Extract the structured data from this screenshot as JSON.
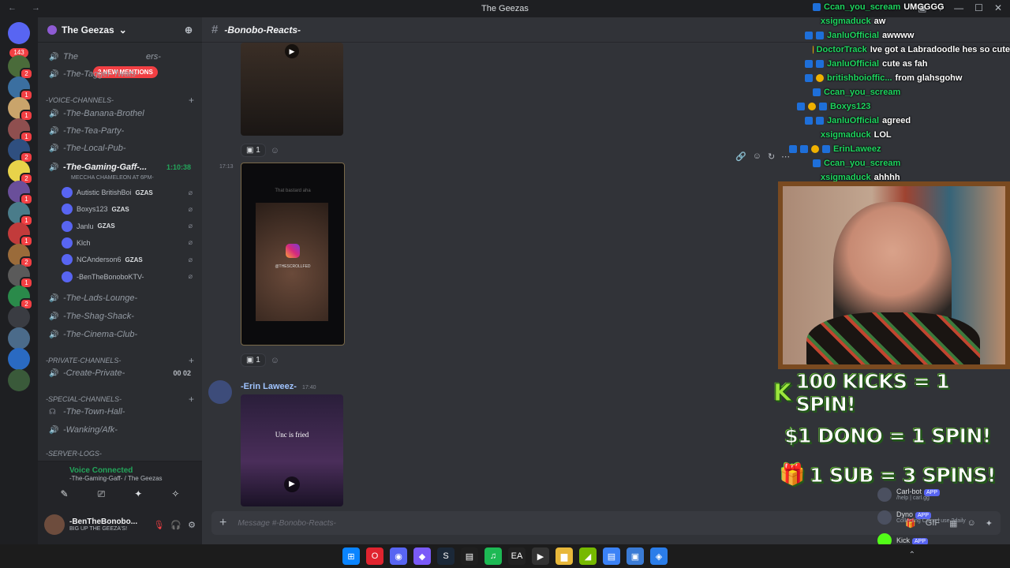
{
  "window": {
    "title": "The Geezas",
    "nav": "← →",
    "controls": [
      "▣",
      "?",
      "—",
      "☐",
      "✕"
    ]
  },
  "guild_bar": {
    "home_badge": "143",
    "guilds": [
      {
        "badge": "2",
        "color": "#4a6b3a"
      },
      {
        "badge": "1",
        "color": "#3b6fa0"
      },
      {
        "badge": "1",
        "color": "#c9a46b"
      },
      {
        "badge": "1",
        "color": "#8f4f4f"
      },
      {
        "badge": "2",
        "color": "#2f4f7f"
      },
      {
        "badge": "2",
        "color": "#e8d34a"
      },
      {
        "badge": "1",
        "color": "#6a4f9a"
      },
      {
        "badge": "1",
        "color": "#4a7c8a"
      },
      {
        "badge": "1",
        "color": "#c23b3b"
      },
      {
        "badge": "2",
        "color": "#9a6b3a"
      },
      {
        "badge": "1",
        "color": "#5a5a5a"
      },
      {
        "badge": "2",
        "color": "#2a8a4a"
      },
      {
        "badge": "",
        "color": "#3a3c42"
      },
      {
        "badge": "",
        "color": "#4b6b8a"
      },
      {
        "badge": "",
        "color": "#2a6ac2"
      },
      {
        "badge": "",
        "color": "#3a5a3a"
      }
    ]
  },
  "server": {
    "name": "The Geezas",
    "chevron": "⌄",
    "mention_pill": "2 NEW MENTIONS",
    "channels_top": [
      {
        "label": "The",
        "tail": "ers-",
        "icon": "🔊"
      },
      {
        "label": "-The-Tagger-Twats-",
        "icon": "🔊"
      }
    ],
    "voice_category": "-VOICE-CHANNELS-",
    "voice_channels": [
      {
        "label": "-The-Banana-Brothel",
        "icon": "🔊"
      },
      {
        "label": "-The-Tea-Party-",
        "icon": "🔊"
      },
      {
        "label": "-The-Local-Pub-",
        "icon": "🔊"
      },
      {
        "label": "-The-Gaming-Gaff-...",
        "icon": "🔊",
        "time": "1:10:38"
      }
    ],
    "event_line": "MECCHA CHAMELEON AT 6PM-",
    "voice_users": [
      {
        "name": "Autistic BritishBoi",
        "tag": "GZAS"
      },
      {
        "name": "Boxys123",
        "tag": "GZAS"
      },
      {
        "name": "Janlu",
        "tag": "GZAS"
      },
      {
        "name": "Klch",
        "tag": ""
      },
      {
        "name": "NCAnderson6",
        "tag": "GZAS"
      },
      {
        "name": "-BenTheBonoboKTV-",
        "tag": ""
      }
    ],
    "voice_channels_2": [
      {
        "label": "-The-Lads-Lounge-",
        "icon": "🔊"
      },
      {
        "label": "-The-Shag-Shack-",
        "icon": "🔊"
      },
      {
        "label": "-The-Cinema-Club-",
        "icon": "🔊"
      }
    ],
    "private_category": "-PRIVATE-CHANNELS-",
    "create_private": {
      "label": "-Create-Private-",
      "count": "00  02"
    },
    "special_category": "-SPECIAL-CHANNELS-",
    "special_channels": [
      {
        "label": "-The-Town-Hall-",
        "icon": "☊"
      },
      {
        "label": "-Wanking/Afk-",
        "icon": "🔊"
      }
    ],
    "logs_category": "-SERVER-LOGS-"
  },
  "voice_panel": {
    "status": "Voice Connected",
    "location": "-The-Gaming-Gaff- / The Geezas",
    "buttons": [
      "✎",
      "⎚",
      "✦",
      "✧"
    ]
  },
  "user_panel": {
    "name": "-BenTheBonobo...",
    "status": "BIG UP THE GEEZA'S!",
    "controls": [
      "🎙",
      "🎧",
      "⚙"
    ]
  },
  "channel": {
    "name": "-Bonobo-Reacts-",
    "hash": "#",
    "react_count_1": "1",
    "react_count_2": "1",
    "time_mid": "17:13",
    "video_caption_top": "That bastard aha",
    "video_caption_mid": "@THESCROLLFED",
    "author": "-Erin Laweez-",
    "author_time": "17:40",
    "video_caption_bottom": "Unc is fried",
    "hover_tools": [
      "🔗",
      "☺",
      "↻",
      "⋯"
    ]
  },
  "composer": {
    "placeholder": "Message #-Bonobo-Reacts-",
    "tools": [
      "🎁",
      "GIF",
      "▦",
      "☺",
      "✦"
    ]
  },
  "chat_overlay": [
    {
      "user": "Ccan_you_scream",
      "msg": "UMGGGG",
      "badges": [
        "b"
      ]
    },
    {
      "user": "xsigmaduck",
      "msg": "aw",
      "badges": []
    },
    {
      "user": "JanluOfficial",
      "msg": "awwww",
      "badges": [
        "b",
        "b"
      ]
    },
    {
      "user": "DoctorTrack",
      "msg": "Ive got a Labradoodle hes so cute",
      "badges": [
        "y"
      ]
    },
    {
      "user": "JanluOfficial",
      "msg": "cute as fah",
      "badges": [
        "b",
        "b"
      ]
    },
    {
      "user": "britishboioffic...",
      "msg": "from glahsgohw",
      "badges": [
        "b",
        "y"
      ]
    },
    {
      "user": "Ccan_you_scream",
      "msg": "",
      "badges": [
        "b"
      ]
    },
    {
      "user": "Boxys123",
      "msg": "",
      "badges": [
        "b",
        "y",
        "b"
      ]
    },
    {
      "user": "JanluOfficial",
      "msg": "agreed",
      "badges": [
        "b",
        "b"
      ]
    },
    {
      "user": "xsigmaduck",
      "msg": "LOL",
      "badges": []
    },
    {
      "user": "ErinLaweez",
      "msg": "",
      "badges": [
        "b",
        "b",
        "y",
        "b"
      ]
    },
    {
      "user": "Ccan_you_scream",
      "msg": "",
      "badges": [
        "b"
      ]
    },
    {
      "user": "xsigmaduck",
      "msg": "ahhhh",
      "badges": []
    }
  ],
  "promos": [
    {
      "symbol": "K",
      "text": "100 KICKS = 1 SPIN!"
    },
    {
      "symbol": "$",
      "text": "$1 DONO = 1 SPIN!"
    },
    {
      "symbol": "🎁",
      "text": "1 SUB = 3 SPINS!"
    }
  ],
  "member_peek": [
    {
      "name": "Carl-bot",
      "badge": "APP",
      "sub": "/help | carl.gg"
    },
    {
      "name": "Dyno",
      "badge": "APP",
      "sub": "Collecting Coins | use ?daily"
    },
    {
      "name": "Kick",
      "badge": "APP",
      "sub": ""
    }
  ],
  "taskbar": {
    "icons": [
      {
        "glyph": "⊞",
        "color": "#0a84ff"
      },
      {
        "glyph": "O",
        "color": "#e0242f"
      },
      {
        "glyph": "◉",
        "color": "#5865f2"
      },
      {
        "glyph": "◆",
        "color": "#7a5af8"
      },
      {
        "glyph": "S",
        "color": "#1b2838"
      },
      {
        "glyph": "▤",
        "color": "#1f1f1f"
      },
      {
        "glyph": "♫",
        "color": "#1db954"
      },
      {
        "glyph": "EA",
        "color": "#222222"
      },
      {
        "glyph": "▶",
        "color": "#333333"
      },
      {
        "glyph": "▆",
        "color": "#e8b83a"
      },
      {
        "glyph": "◢",
        "color": "#76b900"
      },
      {
        "glyph": "▤",
        "color": "#3b82f6"
      },
      {
        "glyph": "▣",
        "color": "#3a7bd5"
      },
      {
        "glyph": "◈",
        "color": "#2b7de9"
      }
    ],
    "tray": "⌃"
  }
}
